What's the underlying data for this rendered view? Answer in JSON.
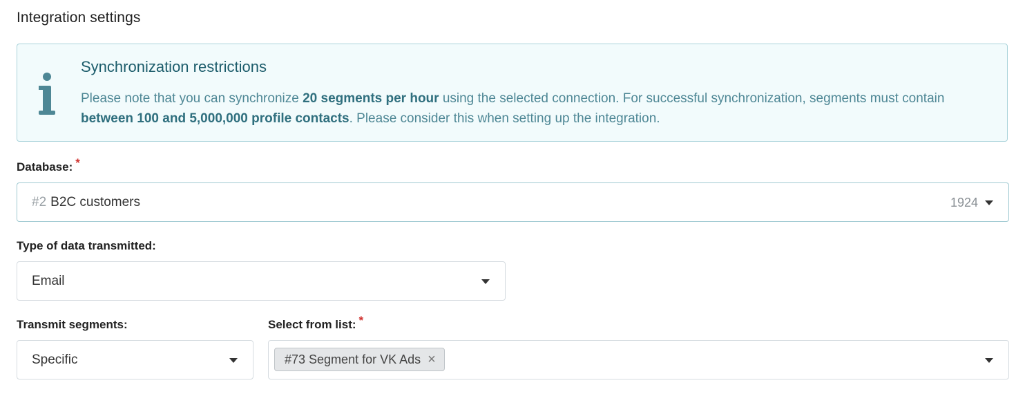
{
  "page": {
    "title": "Integration settings"
  },
  "info": {
    "icon": "info-icon",
    "title": "Synchronization restrictions",
    "text_1": "Please note that you can synchronize ",
    "bold_1": "20 segments per hour",
    "text_2": " using the selected connection. For successful synchronization, segments must contain ",
    "bold_2": "between 100 and 5,000,000 profile contacts",
    "text_3": ". Please consider this when setting up the integration.",
    "accent_color": "#4e8795"
  },
  "database": {
    "label": "Database:",
    "required_mark": "*",
    "prefix": "#2",
    "value": "B2C customers",
    "count": "1924"
  },
  "data_type": {
    "label": "Type of data transmitted:",
    "value": "Email"
  },
  "transmit": {
    "label": "Transmit segments:",
    "value": "Specific"
  },
  "select_list": {
    "label": "Select from list:",
    "required_mark": "*",
    "chips": [
      {
        "label": "#73 Segment for VK Ads",
        "close": "×"
      }
    ]
  }
}
